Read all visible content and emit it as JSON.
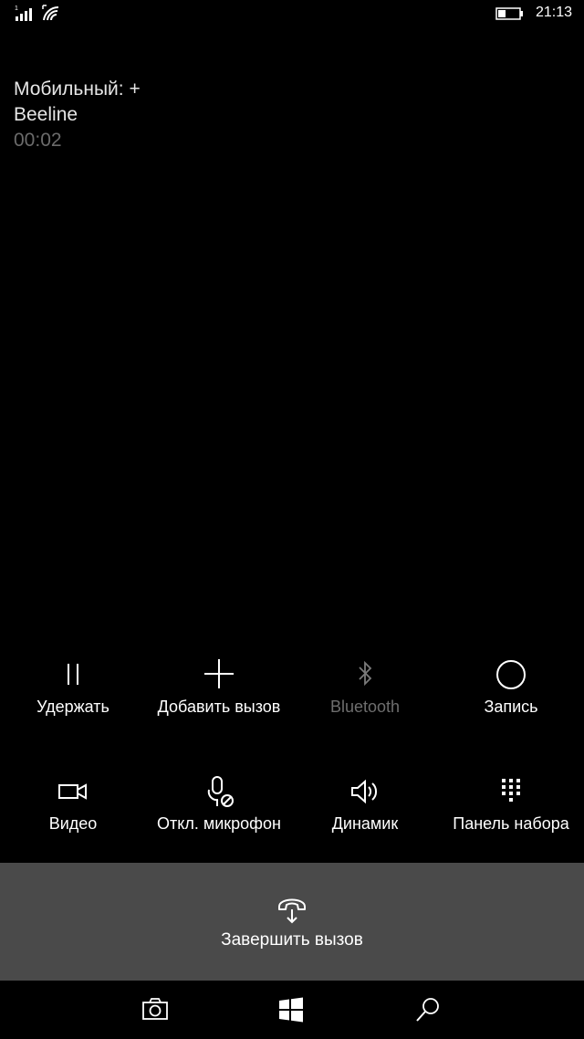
{
  "status": {
    "clock": "21:13",
    "icons": [
      "signal-icon",
      "wifi-icon",
      "battery-icon"
    ]
  },
  "caller": {
    "name": "Мобильный: +",
    "carrier": "Beeline",
    "duration": "00:02"
  },
  "actions": {
    "hold": {
      "label": "Удержать",
      "icon": "pause-icon"
    },
    "add_call": {
      "label": "Добавить вызов",
      "icon": "plus-icon"
    },
    "bluetooth": {
      "label": "Bluetooth",
      "icon": "bluetooth-icon",
      "enabled": false
    },
    "record": {
      "label": "Запись",
      "icon": "record-icon"
    },
    "video": {
      "label": "Видео",
      "icon": "video-camera-icon"
    },
    "mute": {
      "label": "Откл. микрофон",
      "icon": "mic-off-icon"
    },
    "speaker": {
      "label": "Динамик",
      "icon": "speaker-icon"
    },
    "keypad": {
      "label": "Панель набора",
      "icon": "keypad-icon"
    }
  },
  "end_call": {
    "label": "Завершить вызов",
    "icon": "hang-up-icon"
  },
  "nav": {
    "icons": [
      "camera-icon",
      "windows-icon",
      "search-icon"
    ]
  },
  "colors": {
    "background": "#000000",
    "end_call_bar": "#4a4a4a",
    "disabled_text": "#6e6e6e",
    "timer_text": "#6b6b6b"
  }
}
